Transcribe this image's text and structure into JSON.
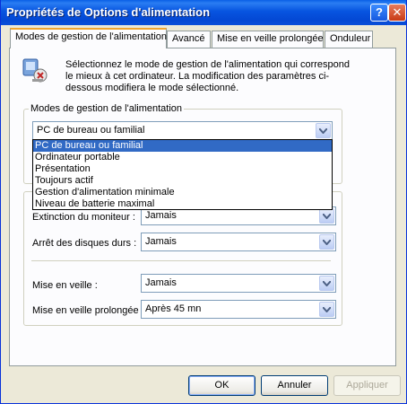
{
  "window": {
    "title": "Propriétés de Options d'alimentation",
    "help_glyph": "?",
    "close_glyph": "✕"
  },
  "tabs": [
    {
      "label": "Modes de gestion de l'alimentation",
      "active": true
    },
    {
      "label": "Avancé",
      "active": false
    },
    {
      "label": "Mise en veille prolongée",
      "active": false
    },
    {
      "label": "Onduleur",
      "active": false
    }
  ],
  "description": "Sélectionnez le mode de gestion de l'alimentation qui correspond le mieux à cet ordinateur. La modification des paramètres ci-dessous modifiera le mode sélectionné.",
  "schemes": {
    "group_label": "Modes de gestion de l'alimentation",
    "selected": "PC de bureau ou familial",
    "options": [
      "PC de bureau ou familial",
      "Ordinateur portable",
      "Présentation",
      "Toujours actif",
      "Gestion d'alimentation minimale",
      "Niveau de batterie maximal"
    ]
  },
  "settings": {
    "monitor_off": {
      "label": "Extinction du moniteur :",
      "value": "Jamais"
    },
    "disks_off": {
      "label": "Arrêt des disques durs :",
      "value": "Jamais"
    },
    "standby": {
      "label": "Mise en veille :",
      "value": "Jamais"
    },
    "hibernate": {
      "label": "Mise en veille prolongée :",
      "value": "Après 45 mn"
    }
  },
  "buttons": {
    "ok": "OK",
    "cancel": "Annuler",
    "apply": "Appliquer"
  },
  "colors": {
    "title_bar": "#0754e0",
    "selection": "#316ac5",
    "tab_highlight": "#f2a52e",
    "dialog_bg": "#ece9d8"
  }
}
